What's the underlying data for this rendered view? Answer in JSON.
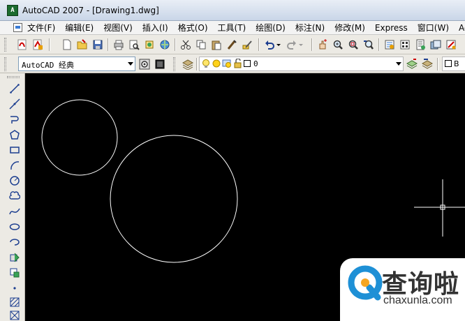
{
  "window": {
    "title": "AutoCAD 2007 - [Drawing1.dwg]",
    "app_icon": "autocad-app-icon"
  },
  "menubar": {
    "items": [
      "文件(F)",
      "编辑(E)",
      "视图(V)",
      "插入(I)",
      "格式(O)",
      "工具(T)",
      "绘图(D)",
      "标注(N)",
      "修改(M)",
      "Express",
      "窗口(W)",
      "Acrob"
    ]
  },
  "workspace_combo": {
    "value": "AutoCAD 经典"
  },
  "layer_combo": {
    "value": "0"
  },
  "bylayer_label": "B",
  "watermark": {
    "text_cn": "查询啦",
    "text_en": "chaxunla.com"
  },
  "colors": {
    "canvas_bg": "#000000",
    "drawing_stroke": "#ffffff",
    "watermark_accent": "#1e90d6"
  }
}
